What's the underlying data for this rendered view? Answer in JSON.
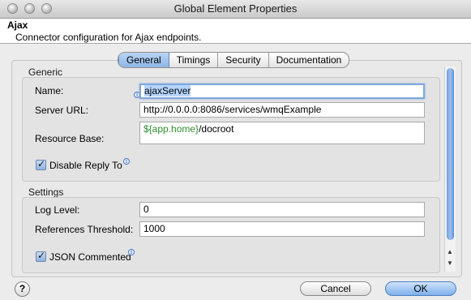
{
  "window": {
    "title": "Global Element Properties"
  },
  "header": {
    "title": "Ajax",
    "description": "Connector configuration for Ajax endpoints."
  },
  "tabs": [
    {
      "label": "General",
      "active": true
    },
    {
      "label": "Timings",
      "active": false
    },
    {
      "label": "Security",
      "active": false
    },
    {
      "label": "Documentation",
      "active": false
    }
  ],
  "generic": {
    "legend": "Generic",
    "name": {
      "label": "Name:",
      "value": "ajaxServer"
    },
    "server_url": {
      "label": "Server URL:",
      "value": "http://0.0.0.0:8086/services/wmqExample"
    },
    "resource_base": {
      "label": "Resource Base:",
      "value_var": "${app.home}",
      "value_rest": "/docroot",
      "var_color": "#2f8f2f"
    },
    "disable_reply_to": {
      "label": "Disable Reply To",
      "checked": true
    }
  },
  "settings": {
    "legend": "Settings",
    "log_level": {
      "label": "Log Level:",
      "value": "0"
    },
    "references_threshold": {
      "label": "References Threshold:",
      "value": "1000"
    },
    "json_commented": {
      "label": "JSON Commented",
      "checked": true
    }
  },
  "footer": {
    "cancel_label": "Cancel",
    "ok_label": "OK",
    "help_label": "?"
  },
  "icons": {
    "info": "info-icon",
    "help": "help-icon"
  }
}
